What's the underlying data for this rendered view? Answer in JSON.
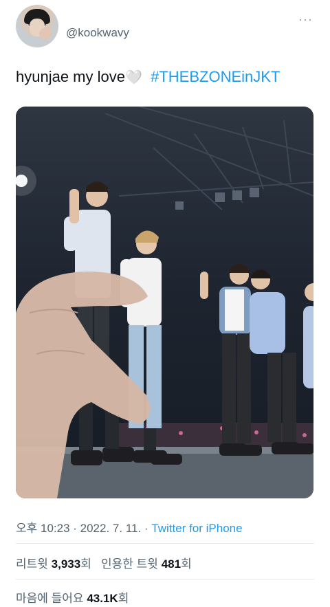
{
  "tweet": {
    "handle": "@kookwavy",
    "text_before": "hyunjae my love",
    "heart_glyph": "🤍",
    "hashtag": "#THEBZONEinJKT",
    "more_glyph": "···"
  },
  "meta": {
    "timestamp": "오후 10:23 · 2022. 7. 11. · ",
    "source": "Twitter for iPhone"
  },
  "stats": {
    "retweets_label": "리트윗",
    "retweets_count": "3,933",
    "retweets_unit": "회",
    "quotes_label": "인용한 트윗",
    "quotes_count": "481",
    "quotes_unit": "회",
    "likes_label": "마음에 들어요",
    "likes_count": "43.1K",
    "likes_unit": "회"
  },
  "colors": {
    "link": "#1d9bf0",
    "secondary_text": "#536471",
    "divider": "#e7e9ea"
  }
}
